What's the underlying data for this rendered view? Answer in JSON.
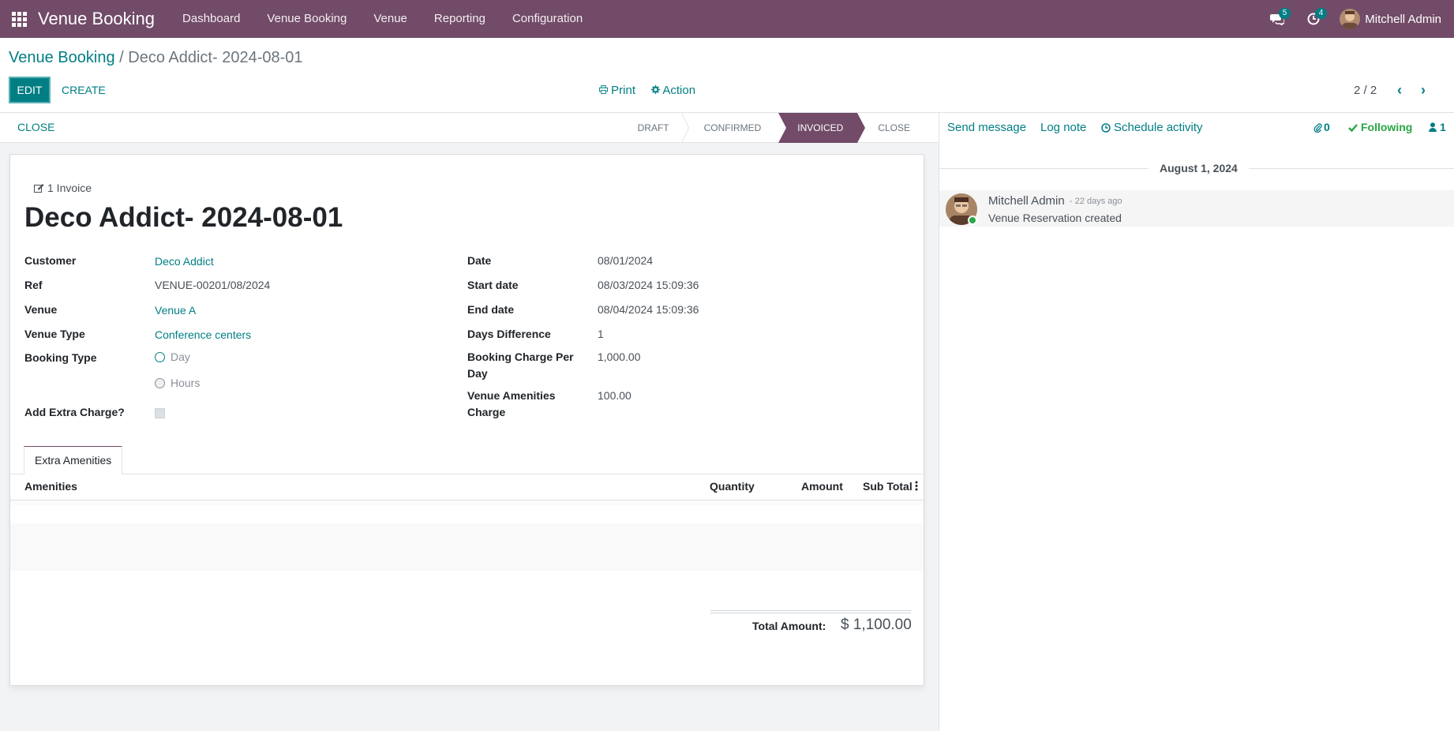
{
  "navbar": {
    "brand": "Venue Booking",
    "menu": [
      "Dashboard",
      "Venue Booking",
      "Venue",
      "Reporting",
      "Configuration"
    ],
    "messages_badge": "5",
    "activities_badge": "4",
    "user_name": "Mitchell Admin"
  },
  "breadcrumb": {
    "parent": "Venue Booking",
    "separator": "/",
    "current": "Deco Addict- 2024-08-01"
  },
  "toolbar": {
    "edit_label": "EDIT",
    "create_label": "CREATE",
    "print_label": "Print",
    "action_label": "Action",
    "pager": "2 / 2"
  },
  "statusbar": {
    "close_label": "CLOSE",
    "stages": [
      "DRAFT",
      "CONFIRMED",
      "INVOICED",
      "CLOSE"
    ],
    "active_stage": "INVOICED"
  },
  "form": {
    "invoice_button": "1 Invoice",
    "title": "Deco Addict- 2024-08-01",
    "left_fields": {
      "customer_label": "Customer",
      "customer_value": "Deco Addict",
      "ref_label": "Ref",
      "ref_value": "VENUE-00201/08/2024",
      "venue_label": "Venue",
      "venue_value": "Venue A",
      "venue_type_label": "Venue Type",
      "venue_type_value": "Conference centers",
      "booking_type_label": "Booking Type",
      "booking_type_options": [
        "Day",
        "Hours"
      ],
      "extra_charge_label": "Add Extra Charge?"
    },
    "right_fields": {
      "date_label": "Date",
      "date_value": "08/01/2024",
      "start_label": "Start date",
      "start_value": "08/03/2024 15:09:36",
      "end_label": "End date",
      "end_value": "08/04/2024 15:09:36",
      "days_label": "Days Difference",
      "days_value": "1",
      "charge_day_label_1": "Booking Charge Per",
      "charge_day_label_2": "Day",
      "charge_day_value": "1,000.00",
      "amenities_charge_label_1": "Venue Amenities",
      "amenities_charge_label_2": "Charge",
      "amenities_charge_value": "100.00"
    },
    "tab_label": "Extra Amenities",
    "columns": [
      "Amenities",
      "Quantity",
      "Amount",
      "Sub Total"
    ],
    "total_label": "Total Amount:",
    "total_value": "$ 1,100.00"
  },
  "chatter": {
    "send_message": "Send message",
    "log_note": "Log note",
    "schedule_activity": "Schedule activity",
    "attachments_count": "0",
    "following_label": "Following",
    "followers_count": "1",
    "date_separator": "August 1, 2024",
    "message": {
      "author": "Mitchell Admin",
      "when": "- 22 days ago",
      "body": "Venue Reservation created"
    }
  },
  "colors": {
    "brand": "#714b67",
    "accent": "#017e84",
    "following": "#28a745"
  }
}
